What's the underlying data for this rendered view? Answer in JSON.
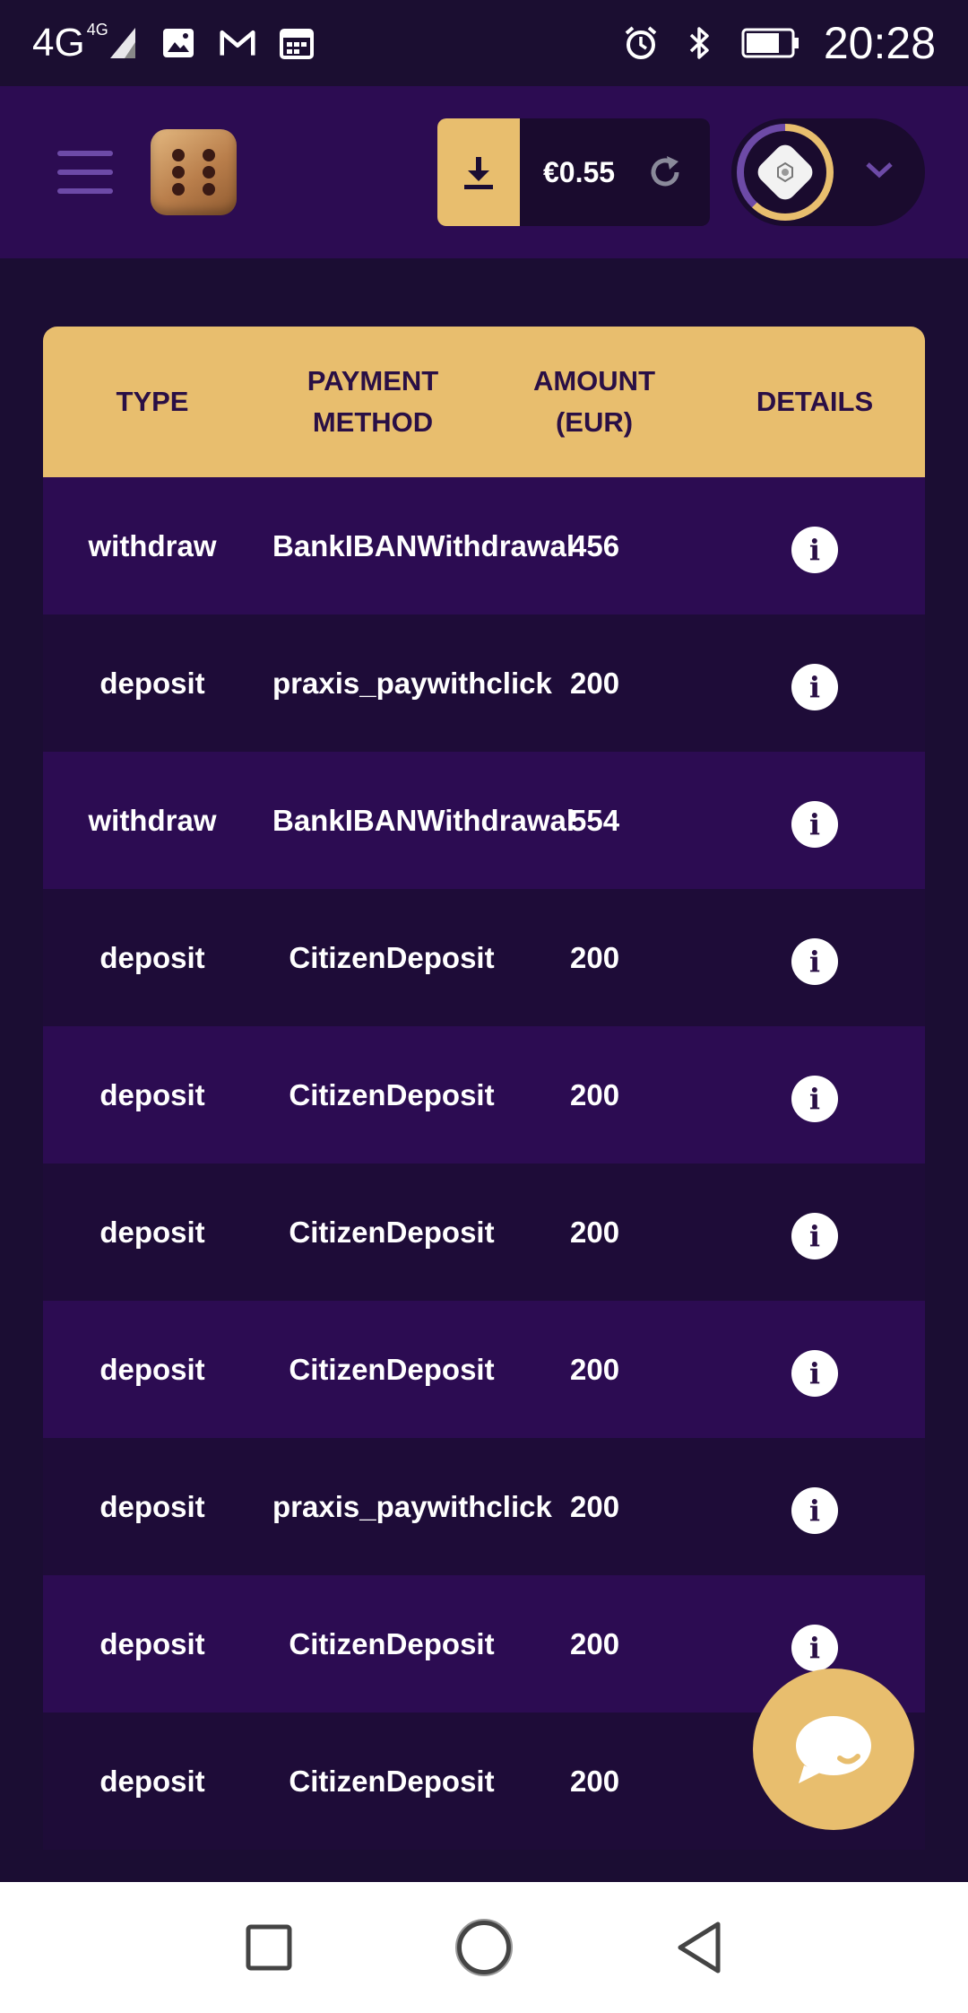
{
  "status_bar": {
    "network": "4G",
    "network_sup": "4G",
    "time": "20:28"
  },
  "header": {
    "balance": "€0.55",
    "icons": [
      "menu-icon",
      "dice-logo",
      "download-icon",
      "refresh-icon",
      "avatar",
      "chevron-down-icon"
    ]
  },
  "table": {
    "headers": {
      "type": "TYPE",
      "method_line1": "PAYMENT",
      "method_line2": "METHOD",
      "amount_line1": "AMOUNT",
      "amount_line2": "(EUR)",
      "details": "DETAILS"
    },
    "rows": [
      {
        "type": "withdraw",
        "method": "BankIBANWithdrawal",
        "amount": "456"
      },
      {
        "type": "deposit",
        "method": "praxis_paywithclick",
        "amount": "200"
      },
      {
        "type": "withdraw",
        "method": "BankIBANWithdrawal",
        "amount": "554"
      },
      {
        "type": "deposit",
        "method": "CitizenDeposit",
        "amount": "200"
      },
      {
        "type": "deposit",
        "method": "CitizenDeposit",
        "amount": "200"
      },
      {
        "type": "deposit",
        "method": "CitizenDeposit",
        "amount": "200"
      },
      {
        "type": "deposit",
        "method": "CitizenDeposit",
        "amount": "200"
      },
      {
        "type": "deposit",
        "method": "praxis_paywithclick",
        "amount": "200"
      },
      {
        "type": "deposit",
        "method": "CitizenDeposit",
        "amount": "200"
      },
      {
        "type": "deposit",
        "method": "CitizenDeposit",
        "amount": "200"
      }
    ],
    "info_glyph": "i"
  },
  "colors": {
    "accent": "#e8be6e",
    "header_bg": "#2c0c52",
    "row_odd": "#2c0c52",
    "row_even": "#1e0c38",
    "page_bg": "#1b0d33"
  }
}
